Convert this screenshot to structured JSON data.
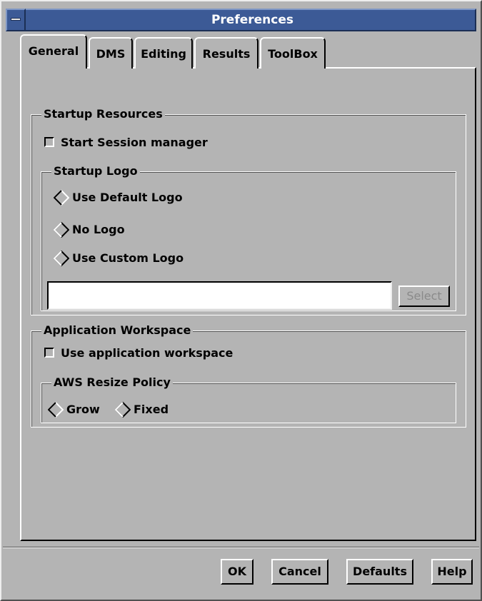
{
  "window": {
    "title": "Preferences"
  },
  "tabs": [
    {
      "label": "General",
      "active": true
    },
    {
      "label": "DMS",
      "active": false
    },
    {
      "label": "Editing",
      "active": false
    },
    {
      "label": "Results",
      "active": false
    },
    {
      "label": "ToolBox",
      "active": false
    }
  ],
  "startup": {
    "legend": "Startup Resources",
    "session_manager": {
      "label": "Start Session manager",
      "checked": false
    },
    "logo": {
      "legend": "Startup Logo",
      "options": [
        {
          "label": "Use Default Logo",
          "selected": true
        },
        {
          "label": "No Logo",
          "selected": false
        },
        {
          "label": "Use Custom Logo",
          "selected": false
        }
      ],
      "custom_path_value": "",
      "select_label": "Select"
    }
  },
  "workspace": {
    "legend": "Application Workspace",
    "use_workspace": {
      "label": "Use application workspace",
      "checked": false
    },
    "resize": {
      "legend": "AWS Resize Policy",
      "options": [
        {
          "label": "Grow",
          "selected": true
        },
        {
          "label": "Fixed",
          "selected": false
        }
      ]
    }
  },
  "buttons": {
    "ok": "OK",
    "cancel": "Cancel",
    "defaults": "Defaults",
    "help": "Help"
  },
  "icons": {
    "window_menu": "window-menu-icon",
    "radio": "diamond-radio-icon",
    "checkbox": "square-checkbox-icon"
  },
  "colors": {
    "title_bar": "#3c5a96",
    "background": "#b4b4b4"
  }
}
